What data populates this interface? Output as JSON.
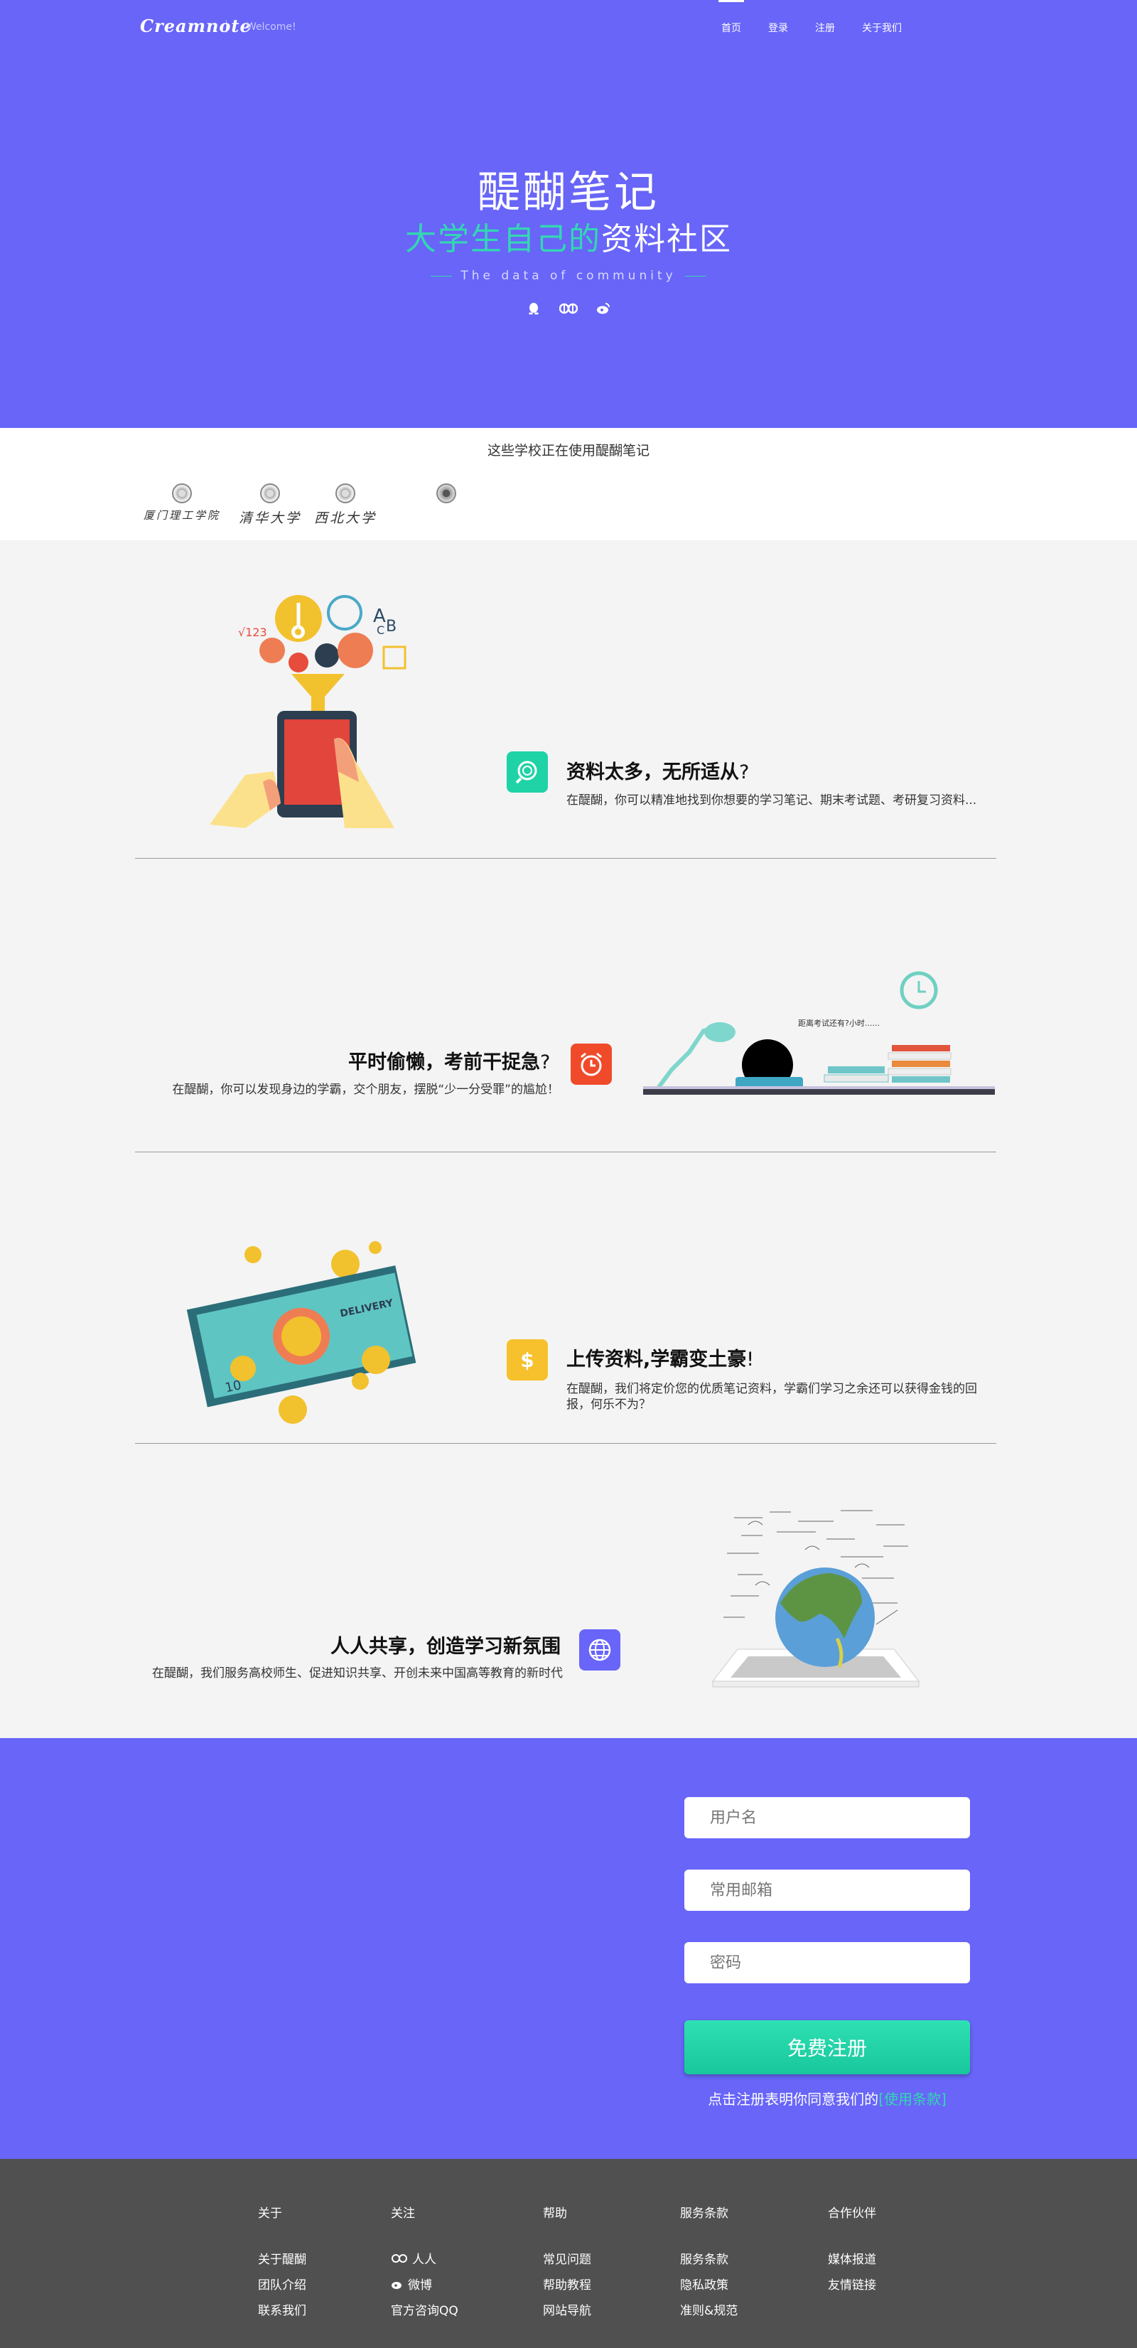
{
  "nav": {
    "logo": "Creamnote",
    "welcome": "Welcome!",
    "links": [
      "首页",
      "登录",
      "注册",
      "关于我们"
    ]
  },
  "hero": {
    "title": "醍醐笔记",
    "subtitle_green": "大学生自己的",
    "subtitle_white": "资料社区",
    "tagline": "The data of community",
    "icons": [
      "qq-icon",
      "renren-icon",
      "weibo-icon"
    ]
  },
  "schools": {
    "title": "这些学校正在使用醍醐笔记",
    "names": [
      "厦门理工学院",
      "清华大学",
      "西北大学",
      ""
    ]
  },
  "features": [
    {
      "title": "资料太多，无所适从",
      "mark": "?",
      "desc": "在醍醐，你可以精准地找到你想要的学习笔记、期末考试题、考研复习资料...",
      "icon": "search-icon",
      "icon_color": "#1fd3a6"
    },
    {
      "title": "平时偷懒，考前干捉急",
      "mark": "?",
      "desc": "在醍醐，你可以发现身边的学霸，交个朋友，摆脱“少一分受罪”的尴尬！",
      "icon": "alarm-clock-icon",
      "icon_color": "#ef4b2b",
      "illus_text": "距离考试还有?小时......"
    },
    {
      "title": "上传资料,学霸变土豪",
      "mark": "!",
      "desc": "在醍醐，我们将定价您的优质笔记资料，学霸们学习之余还可以获得金钱的回报，何乐不为？",
      "icon": "dollar-icon",
      "icon_color": "#f6c12d",
      "illus_text": "DELIVERY"
    },
    {
      "title": "人人共享，创造学习新氛围",
      "mark": "",
      "desc": "在醍醐，我们服务高校师生、促进知识共享、开创未来中国高等教育的新时代",
      "icon": "globe-icon",
      "icon_color": "#6865f8"
    }
  ],
  "register": {
    "username_placeholder": "用户名",
    "email_placeholder": "常用邮箱",
    "password_placeholder": "密码",
    "button": "免费注册",
    "note": "点击注册表明你同意我们的",
    "terms": "[使用条款]"
  },
  "footer": {
    "columns": [
      {
        "head": "关于",
        "items": [
          "关于醍醐",
          "团队介绍",
          "联系我们"
        ]
      },
      {
        "head": "关注",
        "items": [
          "人人",
          "微博",
          "官方咨询QQ"
        ]
      },
      {
        "head": "帮助",
        "items": [
          "常见问题",
          "帮助教程",
          "网站导航"
        ]
      },
      {
        "head": "服务条款",
        "items": [
          "服务条款",
          "隐私政策",
          "准则&规范"
        ]
      },
      {
        "head": "合作伙伴",
        "items": [
          "媒体报道",
          "友情链接"
        ]
      }
    ]
  },
  "colors": {
    "brand_purple": "#6865f8",
    "accent_green": "#33d7b2",
    "footer_bg": "#505050"
  }
}
